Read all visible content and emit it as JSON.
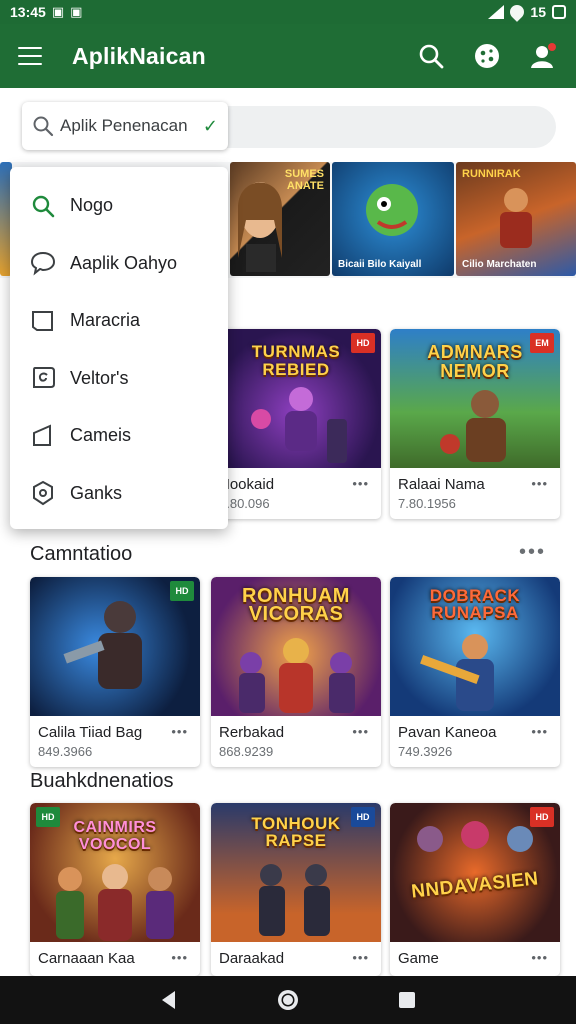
{
  "status": {
    "time": "13:45",
    "left_icons": "ᗅ",
    "battery": "15"
  },
  "app": {
    "title": "AplikNaican"
  },
  "search": {
    "placeholder": "Aplik Penenacan"
  },
  "menu": {
    "items": [
      {
        "label": "Nogo",
        "icon": "search-icon"
      },
      {
        "label": "Aaplik Oahyo",
        "icon": "chat-bubble-icon"
      },
      {
        "label": "Maracria",
        "icon": "tablet-icon"
      },
      {
        "label": "Veltor's",
        "icon": "chat-swirl-icon"
      },
      {
        "label": "Cameis",
        "icon": "flag-icon"
      },
      {
        "label": "Ganks",
        "icon": "badge-icon"
      }
    ]
  },
  "banner": {
    "cards": [
      {
        "top_text": "SUMES\nANATE",
        "caption": ""
      },
      {
        "top_text": "",
        "caption": "Bicaii Bilo Kaiyall"
      },
      {
        "top_text": "RUNNIRAK",
        "caption": "Cilio Marchaten"
      }
    ]
  },
  "row1": [
    {
      "name": "Nookaid",
      "meta": "7.80.096",
      "art_title": "TURNMAS\nREBIED",
      "badge": "HD"
    },
    {
      "name": "Ralaai Nama",
      "meta": "7.80.1956",
      "art_title": "ADMNARS\nNEMOR",
      "badge": "EM"
    }
  ],
  "sections": [
    {
      "title": "Camntatioo",
      "more": "•••"
    },
    {
      "title": "Buahkdnenatios"
    }
  ],
  "row2": [
    {
      "name": "Calila Tiiad Bag",
      "meta": "849.3966",
      "art_title": "",
      "badge": "HD"
    },
    {
      "name": "Rerbakad",
      "meta": "868.9239",
      "art_title": "RONHUAM\nVICORAS",
      "badge": ""
    },
    {
      "name": "Pavan Kaneoa",
      "meta": "749.3926",
      "art_title": "DOBRACK\nRUNAPSA",
      "badge": ""
    }
  ],
  "row3": [
    {
      "name": "Carnaaan Kaa",
      "meta": "",
      "art_title": "CAINMIRS\nVOOCOL",
      "badge": "HD"
    },
    {
      "name": "Daraakad",
      "meta": "",
      "art_title": "TONHOUK\nRAPSE",
      "badge": "HD"
    },
    {
      "name": "Game",
      "meta": "",
      "art_title": "NNDAVASIEN",
      "badge": "HD"
    }
  ],
  "colors": {
    "appbar": "#1f6d35",
    "accent": "#1f8a3c",
    "navbar": "#121212"
  }
}
